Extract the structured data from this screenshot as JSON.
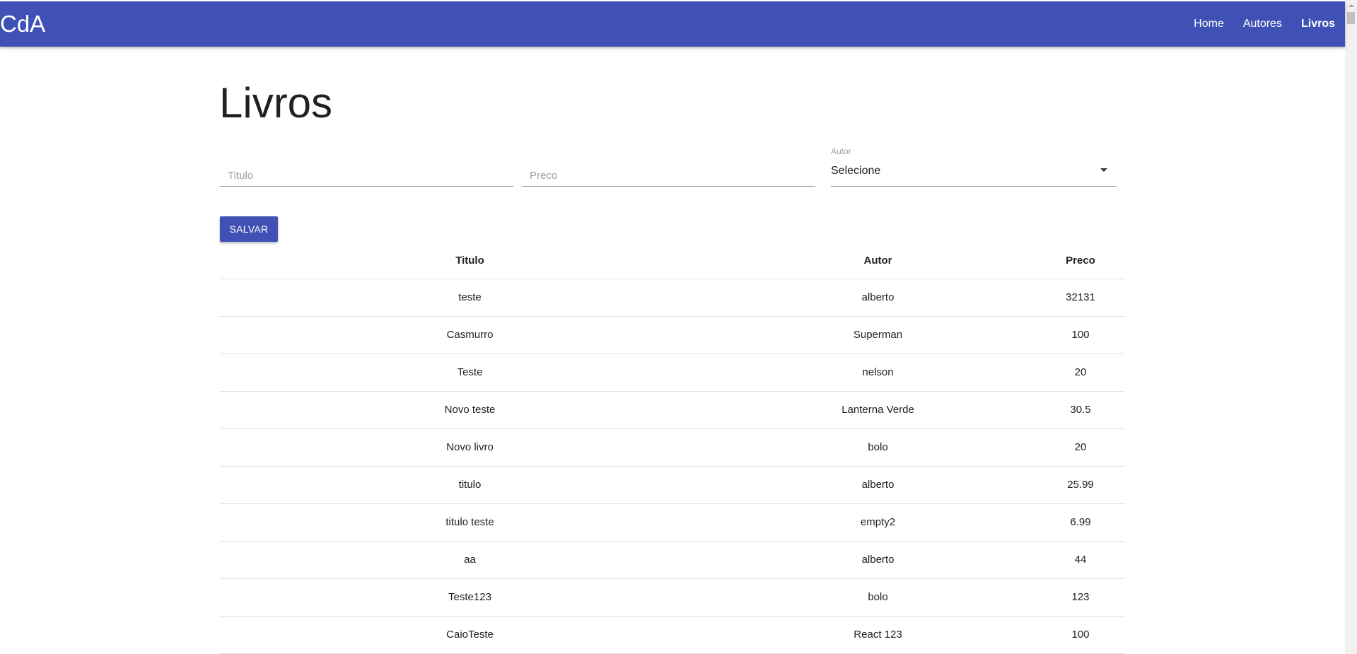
{
  "app": {
    "brand": "CdA"
  },
  "nav": {
    "items": [
      {
        "label": "Home",
        "active": false
      },
      {
        "label": "Autores",
        "active": false
      },
      {
        "label": "Livros",
        "active": true
      }
    ]
  },
  "page": {
    "title": "Livros"
  },
  "form": {
    "titulo": {
      "placeholder": "Titulo",
      "value": ""
    },
    "preco": {
      "placeholder": "Preco",
      "value": ""
    },
    "autor": {
      "label": "Autor",
      "selected": "Selecione"
    },
    "save_label": "SALVAR"
  },
  "table": {
    "headers": [
      "Titulo",
      "Autor",
      "Preco"
    ],
    "rows": [
      [
        "teste",
        "alberto",
        "32131"
      ],
      [
        "Casmurro",
        "Superman",
        "100"
      ],
      [
        "Teste",
        "nelson",
        "20"
      ],
      [
        "Novo teste",
        "Lanterna Verde",
        "30.5"
      ],
      [
        "Novo livro",
        "bolo",
        "20"
      ],
      [
        "titulo",
        "alberto",
        "25.99"
      ],
      [
        "titulo teste",
        "empty2",
        "6.99"
      ],
      [
        "aa",
        "alberto",
        "44"
      ],
      [
        "Teste123",
        "bolo",
        "123"
      ],
      [
        "CaioTeste",
        "React 123",
        "100"
      ]
    ]
  },
  "colors": {
    "primary": "#3f51b5"
  }
}
